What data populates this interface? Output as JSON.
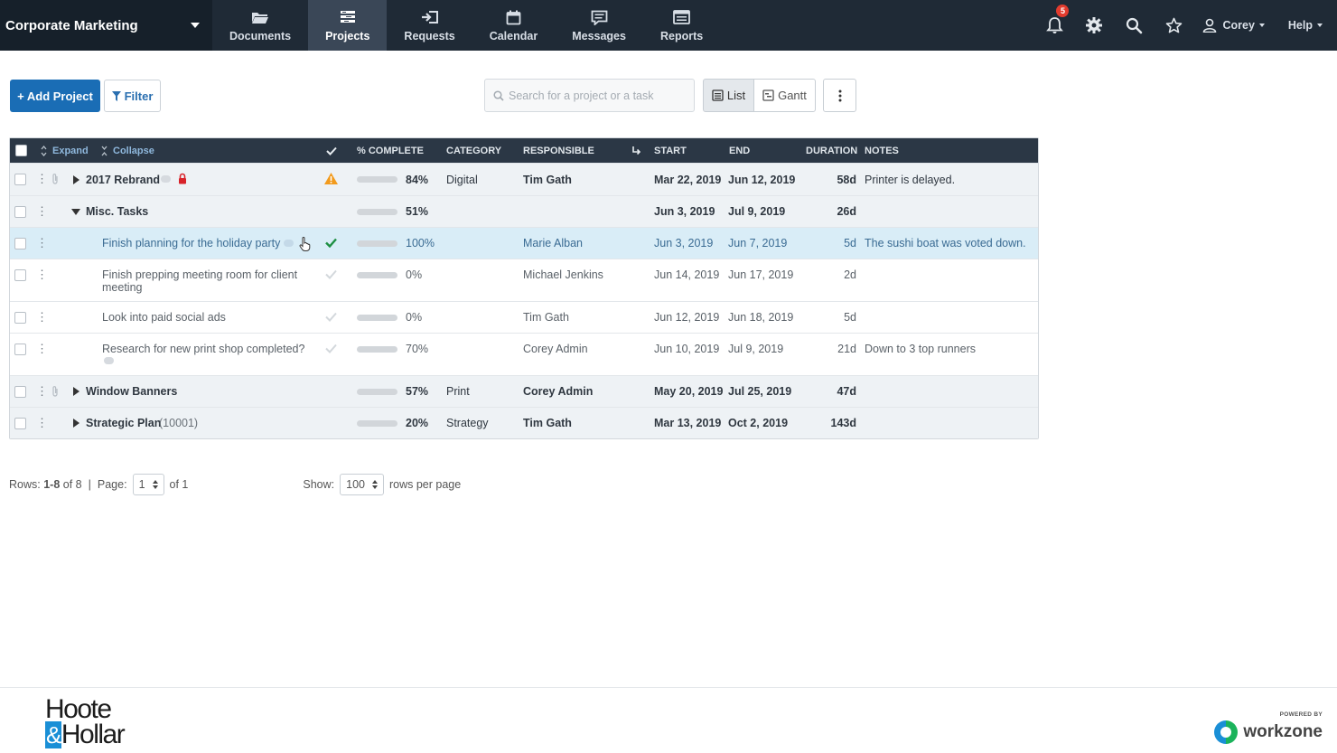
{
  "workspace": {
    "name": "Corporate Marketing"
  },
  "nav": {
    "tabs": [
      {
        "label": "Documents",
        "icon": "folder-icon"
      },
      {
        "label": "Projects",
        "icon": "projects-icon"
      },
      {
        "label": "Requests",
        "icon": "requests-icon"
      },
      {
        "label": "Calendar",
        "icon": "calendar-icon"
      },
      {
        "label": "Messages",
        "icon": "messages-icon"
      },
      {
        "label": "Reports",
        "icon": "reports-icon"
      }
    ],
    "active_tab": "Projects",
    "notifications_count": "5",
    "user_name": "Corey",
    "help_label": "Help"
  },
  "toolbar": {
    "add_project_label": "+ Add Project",
    "filter_label": "Filter",
    "search_placeholder": "Search for a project or a task",
    "list_label": "List",
    "gantt_label": "Gantt",
    "active_view": "List"
  },
  "table": {
    "headers": {
      "expand": "Expand",
      "collapse": "Collapse",
      "complete": "% COMPLETE",
      "category": "CATEGORY",
      "responsible": "RESPONSIBLE",
      "start": "START",
      "end": "END",
      "duration": "DURATION",
      "notes": "NOTES"
    },
    "rows": [
      {
        "kind": "project",
        "name": "2017 Rebrand",
        "percent": "84%",
        "progress": 0.84,
        "bar_color": "#f29b1d",
        "category": "Digital",
        "responsible": "Tim Gath",
        "start": "Mar 22, 2019",
        "end": "Jun 12, 2019",
        "duration": "58d",
        "notes": "Printer is delayed.",
        "has_warning": true,
        "locked": true
      },
      {
        "kind": "group",
        "name": "Misc. Tasks",
        "percent": "51%",
        "progress": 0.51,
        "bar_color": "#1f6aad",
        "category": "",
        "responsible": "",
        "start": "Jun 3, 2019",
        "end": "Jul 9, 2019",
        "duration": "26d",
        "notes": ""
      },
      {
        "kind": "task",
        "name": "Finish planning for the holiday party",
        "percent": "100%",
        "progress": 1.0,
        "bar_color": "#1e8f42",
        "category": "",
        "responsible": "Marie Alban",
        "start": "Jun 3, 2019",
        "end": "Jun 7, 2019",
        "duration": "5d",
        "notes": "The sushi boat was voted down.",
        "done": true
      },
      {
        "kind": "task",
        "name": "Finish prepping meeting room for client",
        "name_line2": "meeting",
        "percent": "0%",
        "progress": 0,
        "bar_color": "#1f6aad",
        "category": "",
        "responsible": "Michael Jenkins",
        "start": "Jun 14, 2019",
        "end": "Jun 17, 2019",
        "duration": "2d",
        "notes": ""
      },
      {
        "kind": "task",
        "name": "Look into paid social ads",
        "percent": "0%",
        "progress": 0,
        "bar_color": "#1f6aad",
        "category": "",
        "responsible": "Tim Gath",
        "start": "Jun 12, 2019",
        "end": "Jun 18, 2019",
        "duration": "5d",
        "notes": ""
      },
      {
        "kind": "task",
        "name": "Research for new print shop completed?",
        "percent": "70%",
        "progress": 0.7,
        "bar_color": "#1f6aad",
        "category": "",
        "responsible": "Corey Admin",
        "start": "Jun 10, 2019",
        "end": "Jul 9, 2019",
        "duration": "21d",
        "notes": "Down to 3 top runners"
      },
      {
        "kind": "project",
        "name": "Window Banners",
        "percent": "57%",
        "progress": 0.57,
        "bar_color": "#1f6aad",
        "category": "Print",
        "responsible": "Corey Admin",
        "start": "May 20, 2019",
        "end": "Jul 25, 2019",
        "duration": "47d",
        "notes": ""
      },
      {
        "kind": "project",
        "name": "Strategic Plan",
        "name_suffix": "(10001)",
        "percent": "20%",
        "progress": 0.2,
        "bar_color": "#1f6aad",
        "category": "Strategy",
        "responsible": "Tim Gath",
        "start": "Mar 13, 2019",
        "end": "Oct 2, 2019",
        "duration": "143d",
        "notes": ""
      }
    ]
  },
  "pagination": {
    "rows_label": "Rows:",
    "rows_range": "1-8",
    "rows_of": "of 8",
    "page_label": "Page:",
    "page_value": "1",
    "page_of": "of 1",
    "show_label": "Show:",
    "per_page_value": "100",
    "per_page_suffix": "rows per page"
  },
  "footer": {
    "brand_line1": "Hoote",
    "brand_amp": "&",
    "brand_line2": "Hollar",
    "powered_by": "POWERED BY",
    "powered_name": "workzone"
  }
}
